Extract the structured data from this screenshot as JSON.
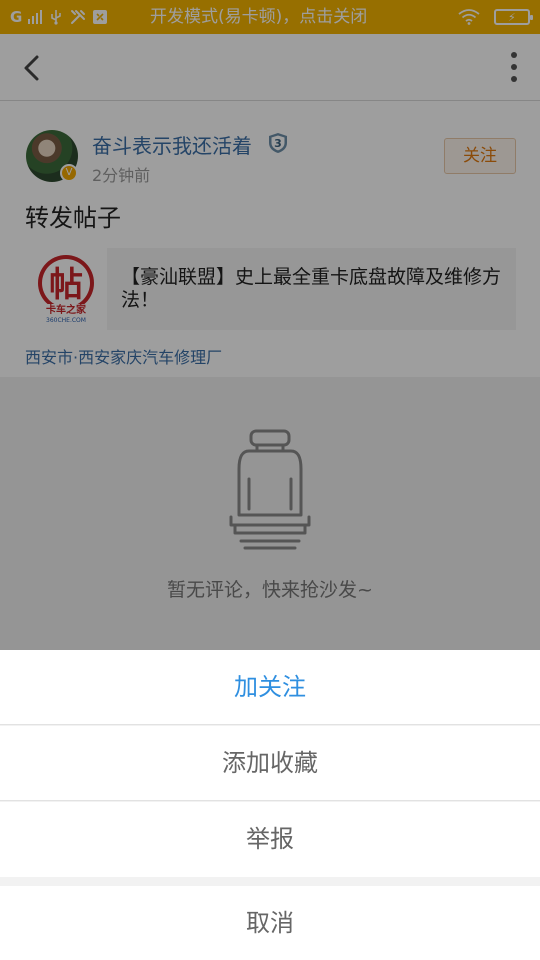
{
  "status_bar": {
    "carrier": "G",
    "mode_text": "开发模式(易卡顿)，点击关闭",
    "background_color": "#F4B400",
    "icons": [
      "signal-icon",
      "usb-icon",
      "tools-icon",
      "app-notification-icon",
      "wifi-icon",
      "battery-charging-icon"
    ]
  },
  "toolbar": {
    "back_icon": "back-arrow-icon",
    "more_icon": "more-vertical-icon"
  },
  "post": {
    "author": "奋斗表示我还活着",
    "level": "3",
    "verified_mark": "V",
    "time": "2分钟前",
    "follow_label": "关注",
    "title": "转发帖子",
    "shared": {
      "thumbnail_brand": "帖",
      "thumbnail_caption": "卡车之家",
      "thumbnail_domain": "360CHE.COM",
      "text": "【豪汕联盟】史上最全重卡底盘故障及维修方法！"
    },
    "location": "西安市·西安家庆汽车修理厂"
  },
  "comments": {
    "empty_icon": "seat-icon",
    "empty_text": "暂无评论，快来抢沙发~"
  },
  "action_sheet": {
    "items": [
      {
        "label": "加关注",
        "color": "#2f8fe0"
      },
      {
        "label": "添加收藏"
      },
      {
        "label": "举报"
      }
    ],
    "cancel_label": "取消"
  }
}
